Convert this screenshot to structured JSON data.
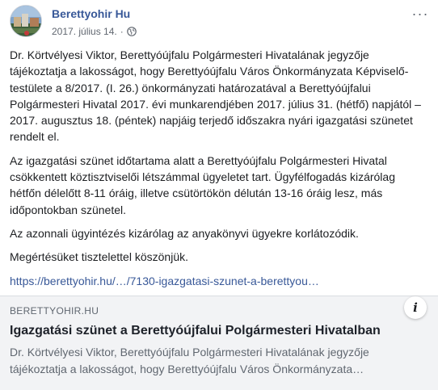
{
  "post": {
    "author": "Berettyohir Hu",
    "date": "2017. július 14.",
    "separator": "·",
    "avatar_icon": "page-avatar-image",
    "privacy_icon": "globe-icon",
    "menu_icon": "more-options-icon",
    "menu_label": "···",
    "paragraphs": [
      "Dr. Körtvélyesi Viktor, Berettyóújfalu Polgármesteri Hivatalának jegyzője tájékoztatja a lakosságot, hogy Berettyóújfalu Város Önkormányzata Képviselő-testülete a 8/2017. (I. 26.) önkormányzati határozatával a Berettyóújfalui Polgármesteri Hivatal 2017. évi munkarendjében 2017. július 31. (hétfő) napjától – 2017. augusztus 18. (péntek) napjáig terjedő időszakra nyári igazgatási szünetet rendelt el.",
      "Az igazgatási szünet időtartama alatt a Berettyóújfalu Polgármesteri Hivatal csökkentett köztisztviselői létszámmal ügyeletet tart. Ügyfélfogadás kizárólag hétfőn délelőtt 8-11 óráig, illetve csütörtökön délután 13-16 óráig lesz, más időpontokban szünetel.",
      "Az azonnali ügyintézés kizárólag az anyakönyvi ügyekre korlátozódik.",
      "Megértésüket tisztelettel köszönjük."
    ],
    "link_text": "https://berettyohir.hu/…/7130-igazgatasi-szunet-a-berettyou…"
  },
  "link_card": {
    "domain": "BERETTYOHIR.HU",
    "title": "Igazgatási szünet a Berettyóújfalui Polgármesteri Hivatalban",
    "description": "Dr. Körtvélyesi Viktor, Berettyóújfalu Polgármesteri Hivatalának jegyzője tájékoztatja a lakosságot, hogy Berettyóújfalu Város Önkormányzata…",
    "info_label": "i",
    "info_icon": "info-icon"
  },
  "colors": {
    "author_link": "#385898",
    "text": "#1c1e21",
    "meta": "#616770",
    "card_bg": "#f2f3f5"
  }
}
